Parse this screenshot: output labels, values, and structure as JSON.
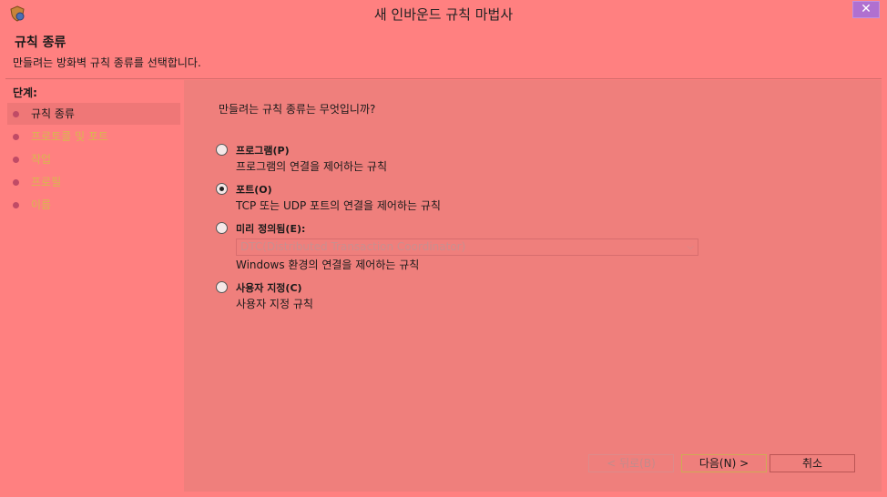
{
  "window": {
    "title": "새 인바운드 규칙 마법사",
    "close_glyph": "✕",
    "icon": "firewall-shield-icon"
  },
  "header": {
    "title": "규칙 종류",
    "description": "만들려는 방화벽 규칙 종류를 선택합니다."
  },
  "steps": {
    "label": "단계:",
    "items": [
      {
        "label": "규칙 종류",
        "state": "active"
      },
      {
        "label": "프로토콜 및 포트",
        "state": "inactive"
      },
      {
        "label": "작업",
        "state": "inactive"
      },
      {
        "label": "프로필",
        "state": "inactive"
      },
      {
        "label": "이름",
        "state": "inactive"
      }
    ]
  },
  "main": {
    "question": "만들려는 규칙 종류는 무엇입니까?",
    "options": [
      {
        "title": "프로그램(P)",
        "description": "프로그램의 연결을 제어하는 규칙",
        "checked": false
      },
      {
        "title": "포트(O)",
        "description": "TCP 또는 UDP 포트의 연결을 제어하는 규칙",
        "checked": true
      },
      {
        "title": "미리 정의됨(E):",
        "description": "",
        "checked": false
      },
      {
        "title": "사용자 지정(C)",
        "description": "사용자 지정 규칙",
        "checked": false
      }
    ],
    "predefined_select": {
      "value": "DTC(Distributed Transaction Coordinator)",
      "description": "Windows 환경의 연결을 제어하는 규칙"
    }
  },
  "buttons": {
    "back": "< 뒤로(B)",
    "next": "다음(N) >",
    "cancel": "취소"
  },
  "colors": {
    "background": "#ff8080",
    "content_bg": "#ef7f7c",
    "inactive_step": "#d9b64f",
    "close_button": "#b070d0"
  }
}
